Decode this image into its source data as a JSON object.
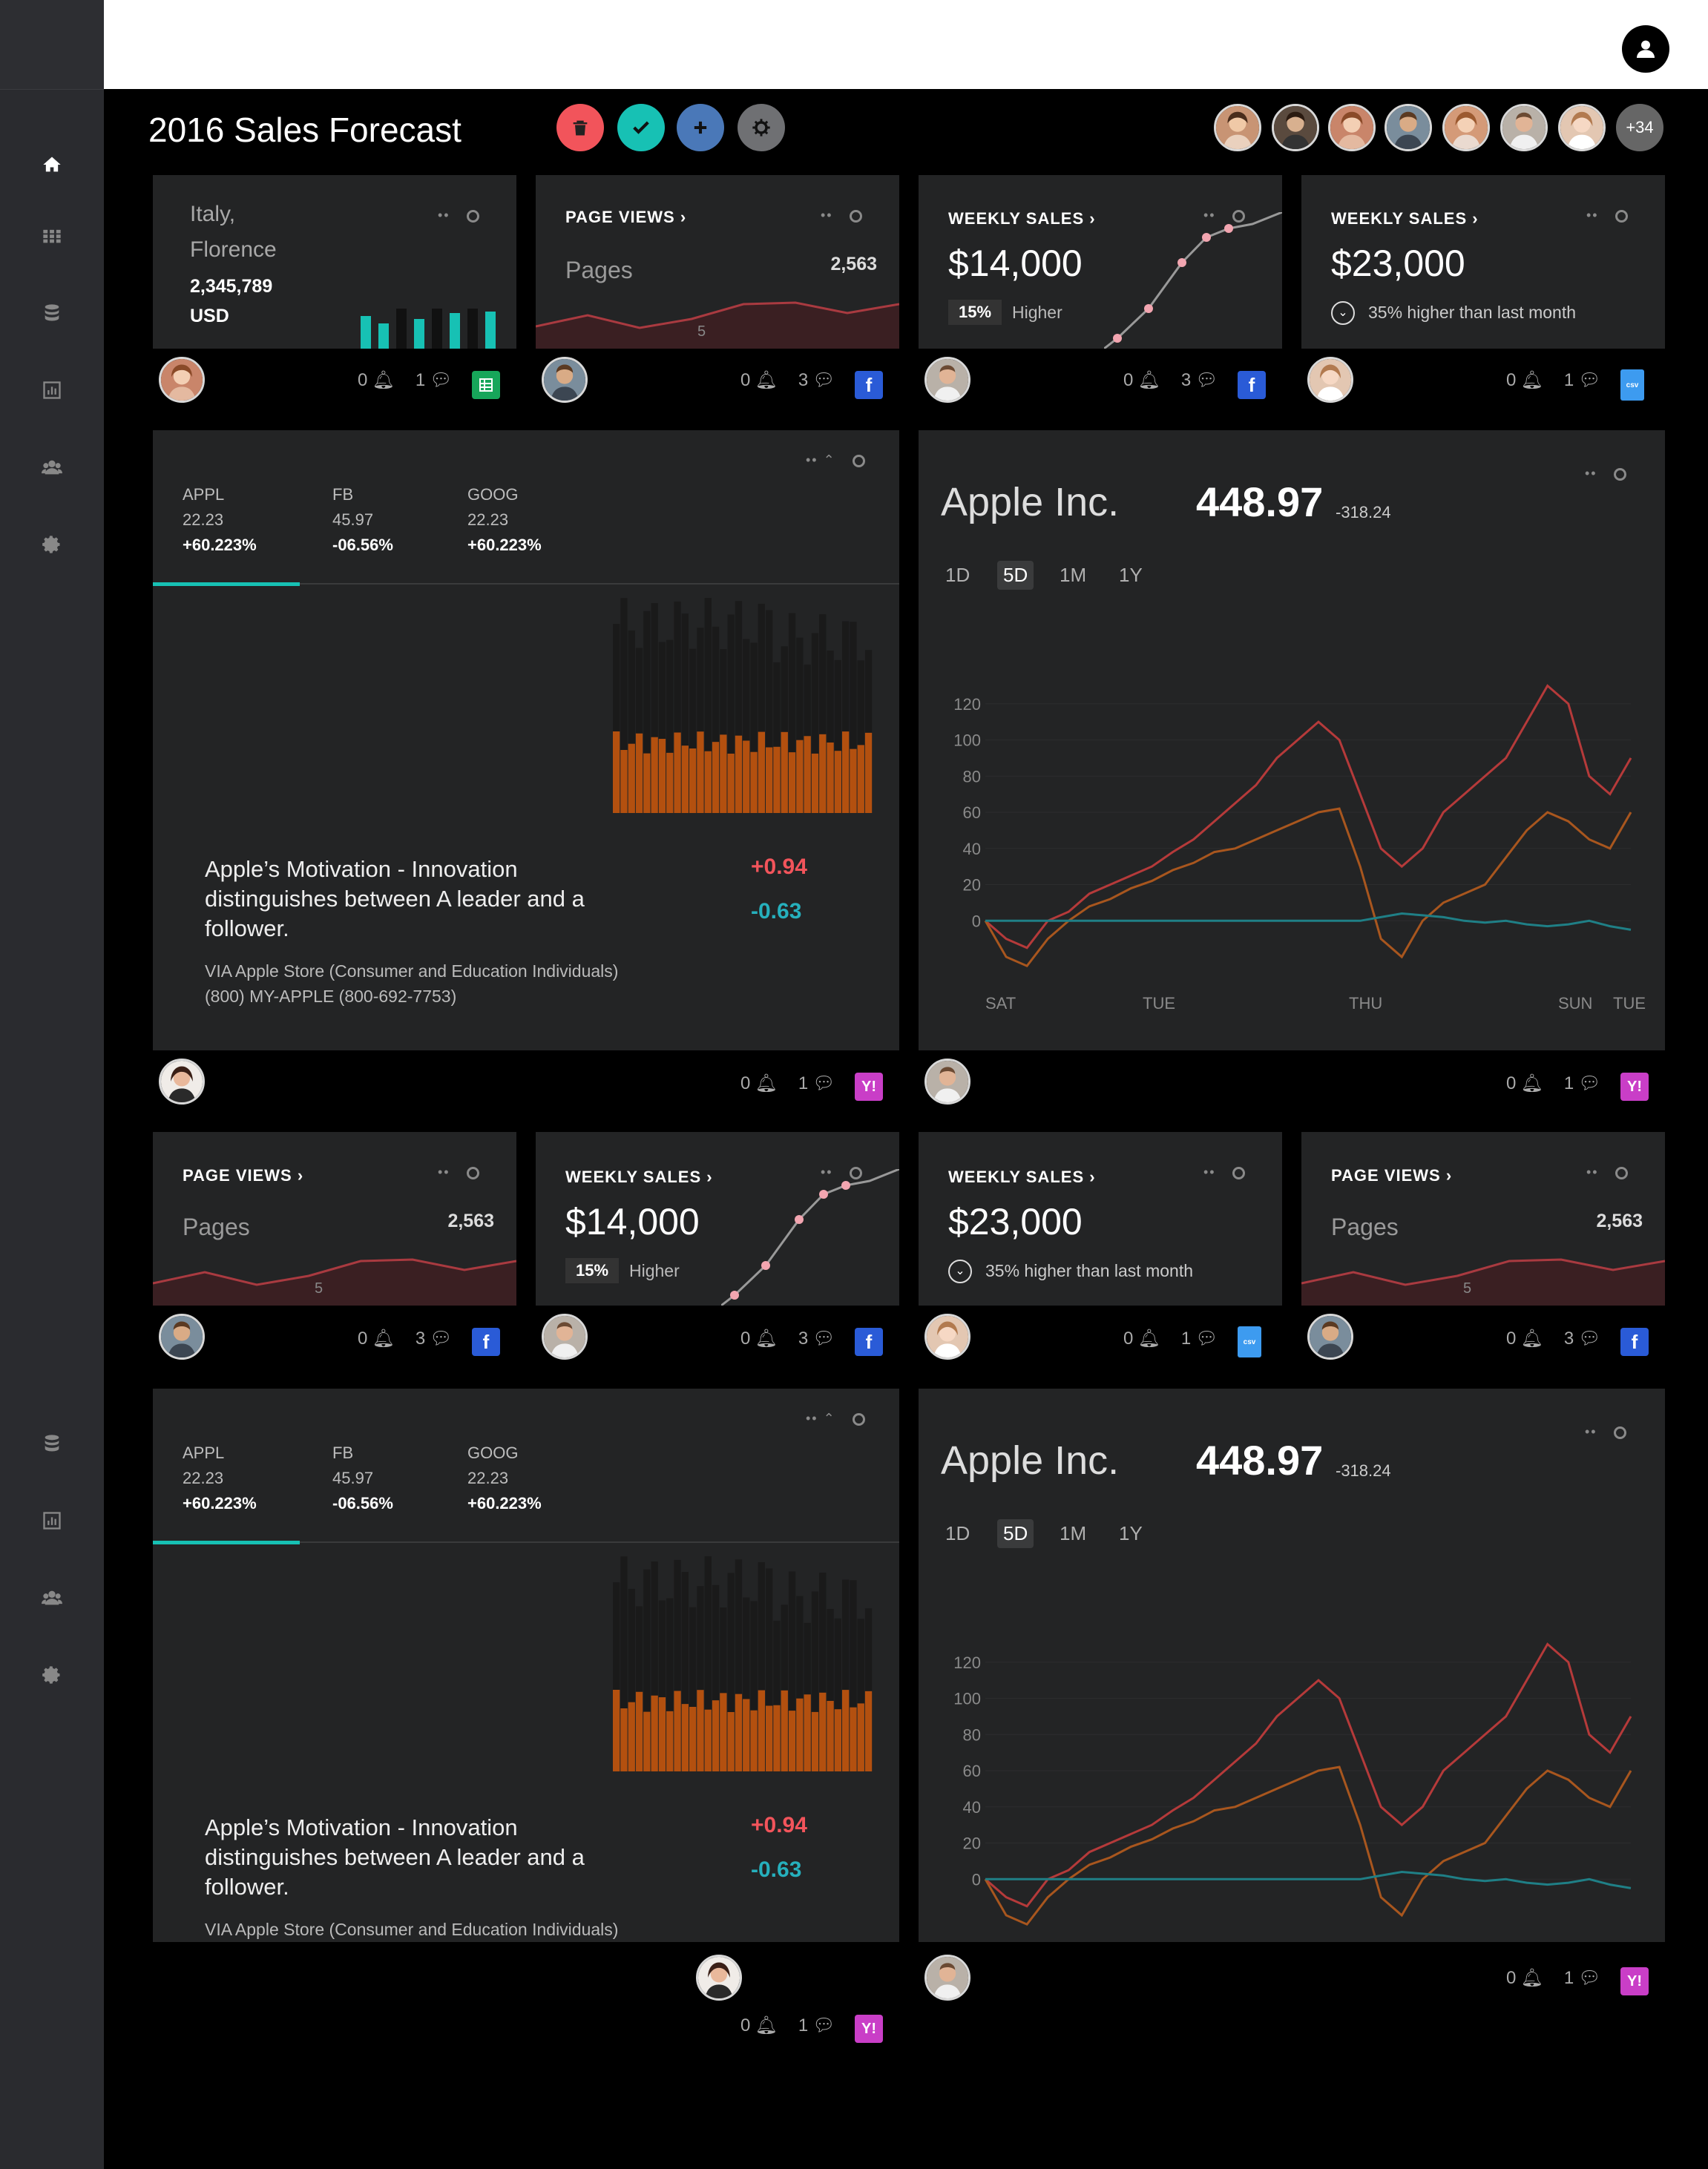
{
  "app": {
    "title": "2016 Sales Forecast"
  },
  "sidebar": {
    "items": [
      {
        "icon": "home-icon"
      },
      {
        "icon": "grid-icon"
      },
      {
        "icon": "database-icon"
      },
      {
        "icon": "bar-chart-icon"
      },
      {
        "icon": "users-icon"
      },
      {
        "icon": "settings-icon"
      },
      {
        "icon": "database-icon"
      },
      {
        "icon": "bar-chart-icon"
      },
      {
        "icon": "users-icon"
      },
      {
        "icon": "settings-icon"
      }
    ]
  },
  "actions": {
    "colors": {
      "delete": "#f2545b",
      "confirm": "#17c1b4",
      "add": "#4a78b8",
      "settings": "#6f7073"
    }
  },
  "team": {
    "more_label": "+34"
  },
  "cards": {
    "location": {
      "city": "Italy,",
      "region": "Florence",
      "amount": "2,345,789",
      "currency": "USD",
      "likes": "0",
      "comments": "1"
    },
    "pageviews1": {
      "title": "PAGE VIEWS",
      "label": "Pages",
      "value": "2,563",
      "axis": "5",
      "likes": "0",
      "comments": "3"
    },
    "weekly1": {
      "title": "WEEKLY SALES",
      "amount": "$14,000",
      "pct": "15%",
      "note": "Higher",
      "likes": "0",
      "comments": "3"
    },
    "weekly2": {
      "title": "WEEKLY SALES",
      "amount": "$23,000",
      "note": "35% higher than last month",
      "likes": "0",
      "comments": "1"
    },
    "pageviews2": {
      "title": "PAGE VIEWS",
      "label": "Pages",
      "value": "2,563",
      "axis": "5",
      "likes": "0",
      "comments": "3"
    },
    "weekly3": {
      "title": "WEEKLY SALES",
      "amount": "$14,000",
      "pct": "15%",
      "note": "Higher",
      "likes": "0",
      "comments": "3"
    },
    "weekly4": {
      "title": "WEEKLY SALES",
      "amount": "$23,000",
      "note": "35% higher than last month",
      "likes": "0",
      "comments": "1"
    },
    "pageviews3": {
      "title": "PAGE VIEWS",
      "label": "Pages",
      "value": "2,563",
      "axis": "5",
      "likes": "0",
      "comments": "3"
    }
  },
  "tickers": [
    {
      "symbol": "APPL",
      "price": "22.23",
      "change": "+60.223%"
    },
    {
      "symbol": "FB",
      "price": "45.97",
      "change": "-06.56%"
    },
    {
      "symbol": "GOOG",
      "price": "22.23",
      "change": "+60.223%"
    }
  ],
  "quote": {
    "text": "Apple’s Motivation - Innovation distinguishes between A leader and a follower.",
    "via": "VIA Apple Store (Consumer and Education Individuals)",
    "phone": "(800) MY-APPLE (800-692-7753)",
    "up": "+0.94",
    "down": "-0.63",
    "likes": "0",
    "comments": "1"
  },
  "stock": {
    "name": "Apple Inc.",
    "price": "448.97",
    "delta": "-318.24",
    "ranges": [
      "1D",
      "5D",
      "1M",
      "1Y"
    ],
    "active_range": "5D",
    "likes": "0",
    "comments": "1"
  },
  "chart_data": {
    "type": "line",
    "ylim": [
      -20,
      140
    ],
    "yticks": [
      "120",
      "100",
      "80",
      "60",
      "40",
      "20",
      "0"
    ],
    "x_labels": [
      "SAT",
      "TUE",
      "THU",
      "SUN",
      "TUE"
    ],
    "series": [
      {
        "color": "#b53a3a",
        "values": [
          0,
          -10,
          -15,
          0,
          5,
          15,
          20,
          25,
          30,
          38,
          45,
          55,
          65,
          75,
          90,
          100,
          110,
          100,
          70,
          40,
          30,
          40,
          60,
          70,
          80,
          90,
          110,
          130,
          120,
          80,
          70,
          90
        ]
      },
      {
        "color": "#a8561e",
        "values": [
          0,
          -20,
          -25,
          -10,
          0,
          8,
          12,
          18,
          22,
          28,
          32,
          38,
          40,
          45,
          50,
          55,
          60,
          62,
          30,
          -10,
          -20,
          0,
          10,
          15,
          20,
          35,
          50,
          60,
          55,
          45,
          40,
          60
        ]
      },
      {
        "color": "#1f7f86",
        "values": [
          0,
          0,
          0,
          0,
          0,
          0,
          0,
          0,
          0,
          0,
          0,
          0,
          0,
          0,
          0,
          0,
          0,
          0,
          0,
          2,
          4,
          3,
          2,
          0,
          -1,
          0,
          -2,
          -3,
          -2,
          0,
          -3,
          -5
        ]
      }
    ]
  },
  "colors": {
    "accent": "#17c1b4",
    "positive": "#f2545b",
    "negative": "#26b0bd",
    "bar_top": "#1a1a1a",
    "bar_bottom": "#b3500f"
  }
}
